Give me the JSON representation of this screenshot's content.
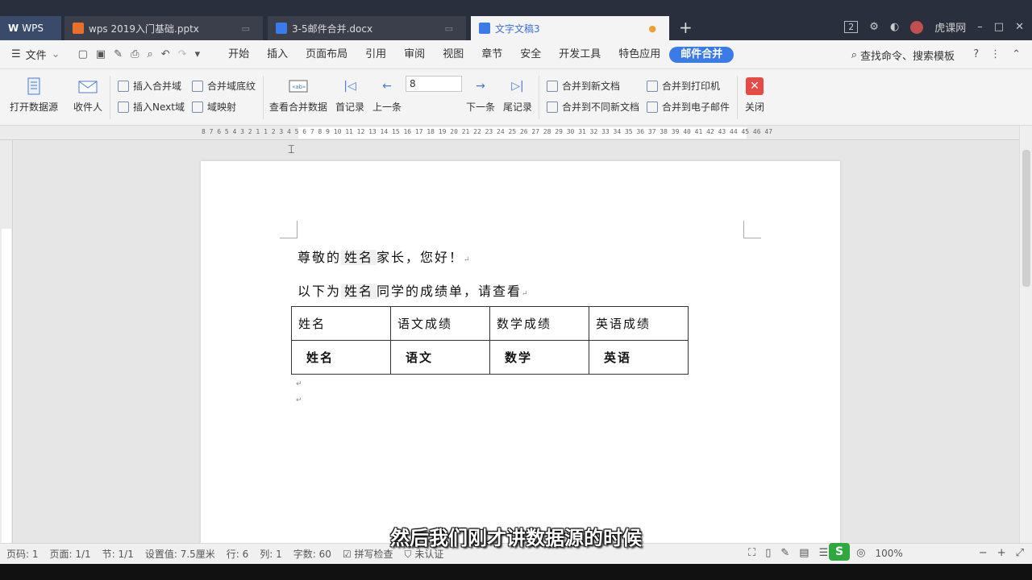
{
  "titlebar": {
    "app_name": "WPS",
    "tabs": [
      {
        "label": "wps 2019入门基础.pptx"
      },
      {
        "label": "3-5邮件合并.docx"
      },
      {
        "label": "文字文稿3"
      }
    ],
    "window_count": "2",
    "user_name": "虎课网"
  },
  "menubar": {
    "file_label": "文件",
    "items": [
      "开始",
      "插入",
      "页面布局",
      "引用",
      "审阅",
      "视图",
      "章节",
      "安全",
      "开发工具",
      "特色应用",
      "邮件合并"
    ],
    "active_item": "邮件合并",
    "search_label": "查找命令、搜索模板"
  },
  "ribbon": {
    "open_source": "打开数据源",
    "recipient": "收件人",
    "insert_field": "插入合并域",
    "field_shading": "合并域底纹",
    "insert_next": "插入Next域",
    "field_map": "域映射",
    "view_merged": "查看合并数据",
    "first_record": "首记录",
    "prev_record": "上一条",
    "record_value": "8",
    "next_record": "下一条",
    "last_record": "尾记录",
    "merge_new_doc": "合并到新文档",
    "merge_diff_docs": "合并到不同新文档",
    "merge_printer": "合并到打印机",
    "merge_email": "合并到电子邮件",
    "close": "关闭"
  },
  "ruler": {
    "numbers": "8  7  6  5  4  3  2  1     1  2  3  4  5  6  7  8  9  10 11 12 13 14 15 16 17 18 19 20 21 22 23 24 25 26 27 28 29 30 31 32 33 34 35 36 37 38 39 40 41 42 43 44 45 46 47"
  },
  "document": {
    "line1_prefix": "尊敬的",
    "line1_field": "姓名",
    "line1_suffix": "家长，您好！",
    "line2_prefix": "以下为",
    "line2_field": "姓名",
    "line2_suffix": "同学的成绩单，请查看",
    "table_header": [
      "姓名",
      "语文成绩",
      "数学成绩",
      "英语成绩"
    ],
    "table_row": [
      "姓名",
      "语文",
      "数学",
      "英语"
    ]
  },
  "statusbar": {
    "page_code": "页码: 1",
    "page": "页面: 1/1",
    "section": "节: 1/1",
    "setting": "设置值: 7.5厘米",
    "row": "行: 6",
    "col": "列: 1",
    "word_count": "字数: 60",
    "spell_check": "拼写检查",
    "cert": "未认证",
    "zoom": "100%"
  },
  "subtitle": "然后我们刚才讲数据源的时候"
}
